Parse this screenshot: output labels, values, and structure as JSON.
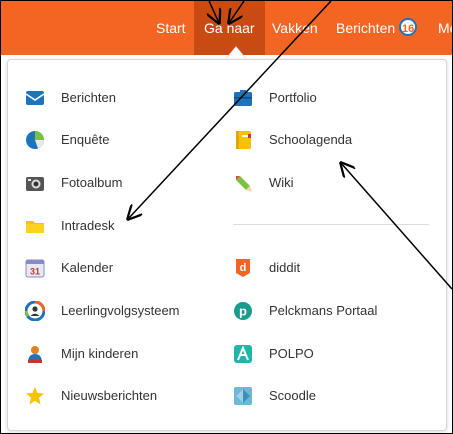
{
  "colors": {
    "topbar": "#f26522",
    "active": "#c94b12",
    "badge_border": "#1e73be"
  },
  "nav": {
    "start": "Start",
    "ga_naar": "Ga naar",
    "vakken": "Vakken",
    "berichten": "Berichten",
    "berichten_count": "16",
    "more": "Me"
  },
  "menu": {
    "left": [
      {
        "label": "Berichten",
        "icon": "envelope-icon"
      },
      {
        "label": "Enquête",
        "icon": "pie-chart-icon"
      },
      {
        "label": "Fotoalbum",
        "icon": "camera-icon"
      },
      {
        "label": "Intradesk",
        "icon": "folder-icon"
      },
      {
        "label": "Kalender",
        "icon": "calendar-icon",
        "calendar_day": "31"
      },
      {
        "label": "Leerlingvolgsysteem",
        "icon": "student-tracking-icon"
      },
      {
        "label": "Mijn kinderen",
        "icon": "child-icon"
      },
      {
        "label": "Nieuwsberichten",
        "icon": "star-icon"
      }
    ],
    "right": [
      {
        "label": "Portfolio",
        "icon": "portfolio-icon"
      },
      {
        "label": "Schoolagenda",
        "icon": "agenda-icon"
      },
      {
        "label": "Wiki",
        "icon": "pencil-icon"
      },
      {
        "label": "diddit",
        "icon": "diddit-icon"
      },
      {
        "label": "Pelckmans Portaal",
        "icon": "pelckmans-icon"
      },
      {
        "label": "POLPO",
        "icon": "polpo-icon"
      },
      {
        "label": "Scoodle",
        "icon": "scoodle-icon"
      }
    ]
  }
}
